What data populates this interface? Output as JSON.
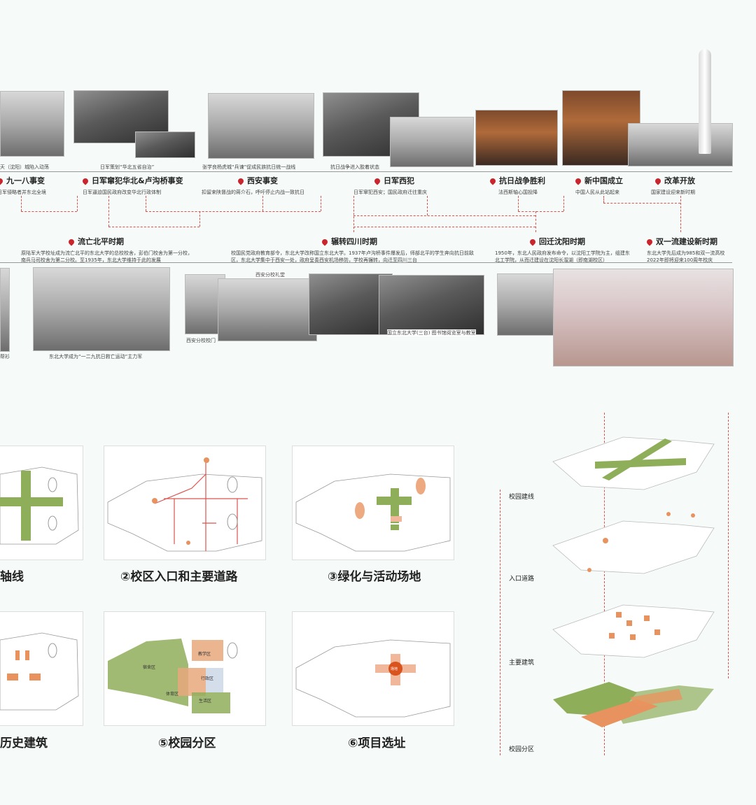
{
  "timeline": {
    "top_captions": [
      "天（沈阳）城陷入动荡",
      "日军策划“华北五省自治”",
      "张学良杨虎城“兵谏”促成民族抗日统一战线",
      "抗日战争进入胶着状态"
    ],
    "events": [
      {
        "title": "九一八事变",
        "desc": "日军侵略者并东北全境"
      },
      {
        "title": "日军窜犯华北&卢沟桥事变",
        "desc": "日军逼迫国民政府改变华北行政体制"
      },
      {
        "title": "西安事变",
        "desc": "扣留来陕督战的蒋介石，呼吁停止内战一致抗日"
      },
      {
        "title": "日军西犯",
        "desc": "日军窜犯西安；国民政府迁往重庆"
      },
      {
        "title": "抗日战争胜利",
        "desc": "法西斯轴心国投降"
      },
      {
        "title": "新中国成立",
        "desc": "中国人民从此站起来"
      },
      {
        "title": "改革开放",
        "desc": "国家建设迎来新时期"
      }
    ],
    "periods": [
      {
        "title": "流亡北平时期",
        "desc": "原陆军大学校址成为流亡北平的东北大学的总校校舍，彭伯门校舍为第一分校，南兵马司校舍为第二分校。至1935年，东北大学维持于此的发展"
      },
      {
        "title": "辗转四川时期",
        "desc": "校国民党政府教育部令，东北大学改称国立东北大学。1937年卢沟桥事件爆发后，师部北平的学生奔向抗日前敌区，东北大学集中于西安一处，政府呈奏西安机场移防，学校再辗转，向迁至四川三台"
      },
      {
        "title": "回迁沈阳时期",
        "desc": "1950年，东北人民政府发布命令，以沈阳工学院为主，组建东北工学院，从而迁建设在沈阳长溜湖（即南湖校区）"
      },
      {
        "title": "双一流建设新时期",
        "desc": "东北大学先后成为985和双一流高校 2022年即将迎来100周年校庆"
      }
    ],
    "bottom_captions": [
      "东北大学成为“一二九抗日救亡运动”主力军",
      "西安分校礼堂",
      "西安分校校门",
      "国立东北大学(三台) 图书馆阅览室与教室",
      "帮衫"
    ]
  },
  "maps": [
    {
      "label": "轴线"
    },
    {
      "label": "②校区入口和主要道路"
    },
    {
      "label": "③绿化与活动场地"
    },
    {
      "label": "历史建筑"
    },
    {
      "label": "⑤校园分区"
    },
    {
      "label": "⑥项目选址"
    }
  ],
  "zone_labels": [
    "教学区",
    "宿舍区",
    "体育区",
    "生活区",
    "行政区"
  ],
  "site_marker": "场地",
  "layers": [
    {
      "label": "校园建线"
    },
    {
      "label": "入口道路"
    },
    {
      "label": "主要建筑"
    },
    {
      "label": "校园分区"
    }
  ],
  "colors": {
    "accent_red": "#c8262c",
    "green": "#8fae5a",
    "orange": "#e8935f"
  }
}
